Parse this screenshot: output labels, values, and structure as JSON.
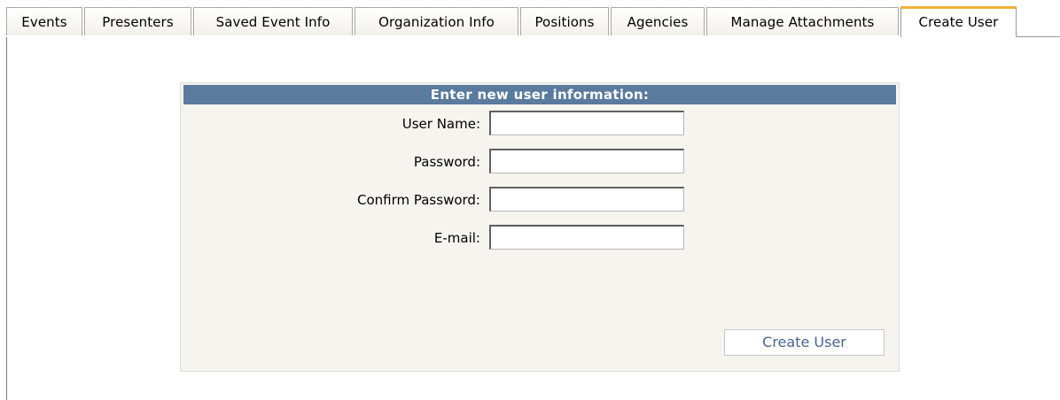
{
  "tabs": [
    {
      "label": "Events",
      "active": false
    },
    {
      "label": "Presenters",
      "active": false
    },
    {
      "label": "Saved Event Info",
      "active": false
    },
    {
      "label": "Organization Info",
      "active": false
    },
    {
      "label": "Positions",
      "active": false
    },
    {
      "label": "Agencies",
      "active": false
    },
    {
      "label": "Manage Attachments",
      "active": false
    },
    {
      "label": "Create User",
      "active": true
    }
  ],
  "form": {
    "header": "Enter new user information:",
    "fields": {
      "username": {
        "label": "User Name:",
        "value": ""
      },
      "password": {
        "label": "Password:",
        "value": ""
      },
      "confirm_password": {
        "label": "Confirm Password:",
        "value": ""
      },
      "email": {
        "label": "E-mail:",
        "value": ""
      }
    },
    "submit_label": "Create User"
  },
  "colors": {
    "header_bg": "#5a7a9e",
    "active_tab_accent": "#f5b13b",
    "panel_bg": "#f5f4ef",
    "button_text": "#48648c"
  }
}
